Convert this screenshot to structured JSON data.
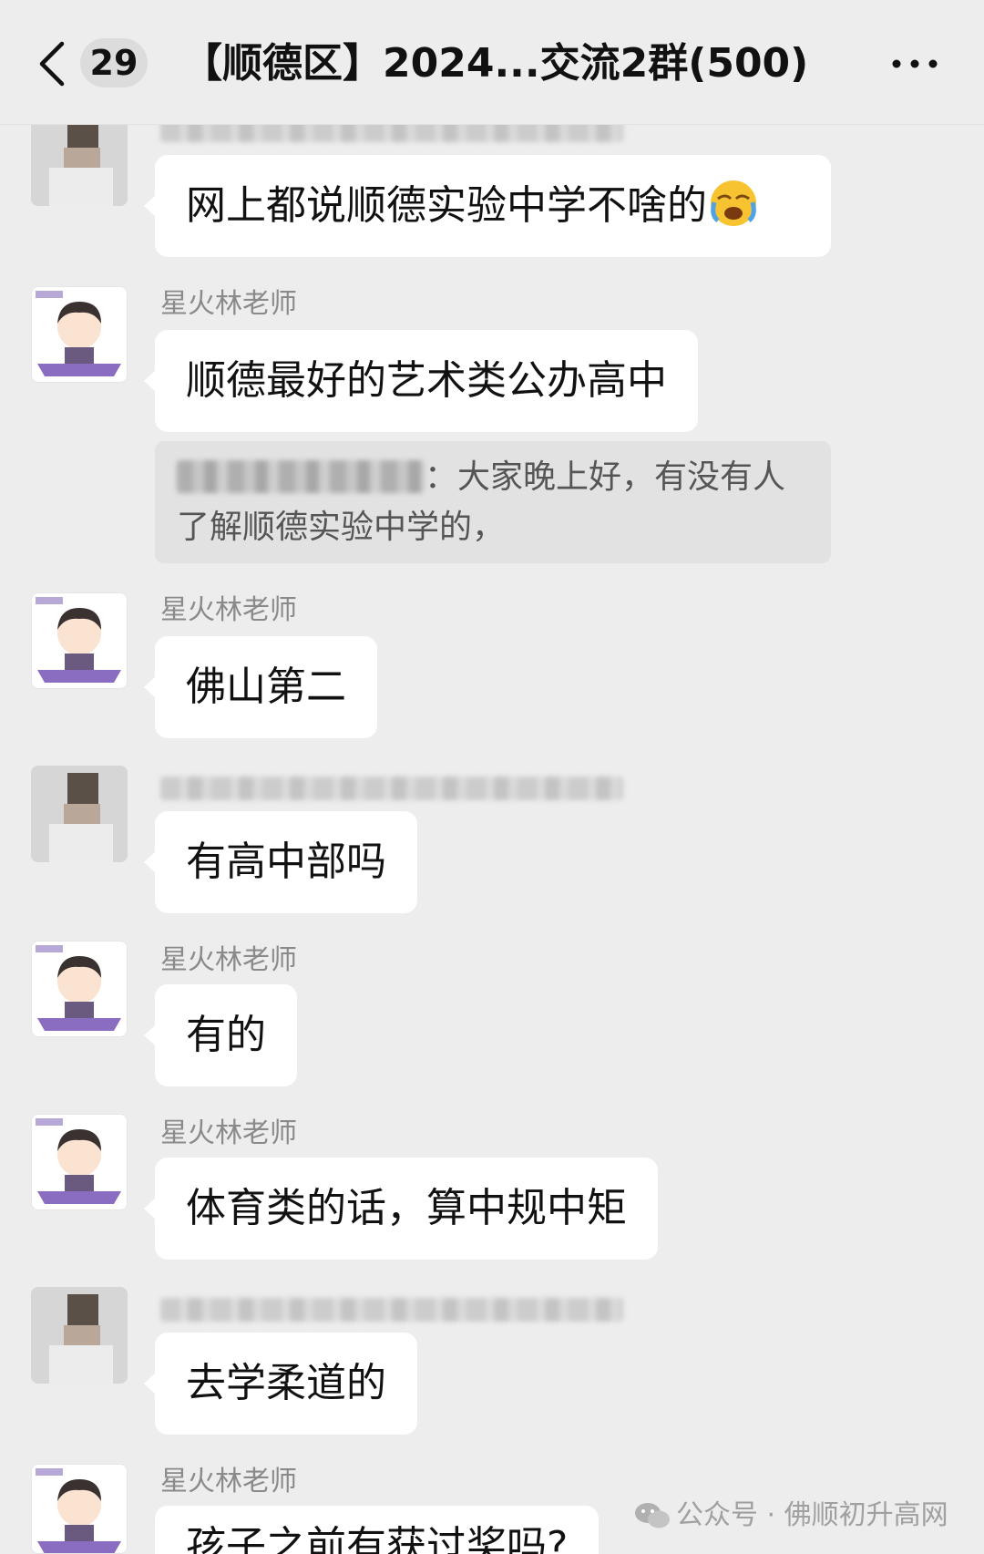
{
  "header": {
    "unread_count": "29",
    "title": "【顺德区】2024...交流2群(500)"
  },
  "messages": [
    {
      "sender": "",
      "text": "网上都说顺德实验中学不啥的",
      "emoji": "crying-face-icon"
    },
    {
      "sender": "星火林老师",
      "text": "顺德最好的艺术类公办高中",
      "quote": {
        "text_after_name": "：大家晚上好，有没有人",
        "line2": "了解顺德实验中学的，"
      }
    },
    {
      "sender": "星火林老师",
      "text": "佛山第二"
    },
    {
      "sender": "",
      "text": "有高中部吗"
    },
    {
      "sender": "星火林老师",
      "text": "有的"
    },
    {
      "sender": "星火林老师",
      "text": "体育类的话，算中规中矩"
    },
    {
      "sender": "",
      "text": "去学柔道的"
    },
    {
      "sender": "星火林老师",
      "text": "孩子之前有获过奖吗?"
    }
  ],
  "watermark": "公众号 · 佛顺初升高网",
  "colors": {
    "bg": "#ededed",
    "bubble": "#ffffff",
    "quote": "#e2e2e2",
    "name": "#8a8a8a"
  }
}
